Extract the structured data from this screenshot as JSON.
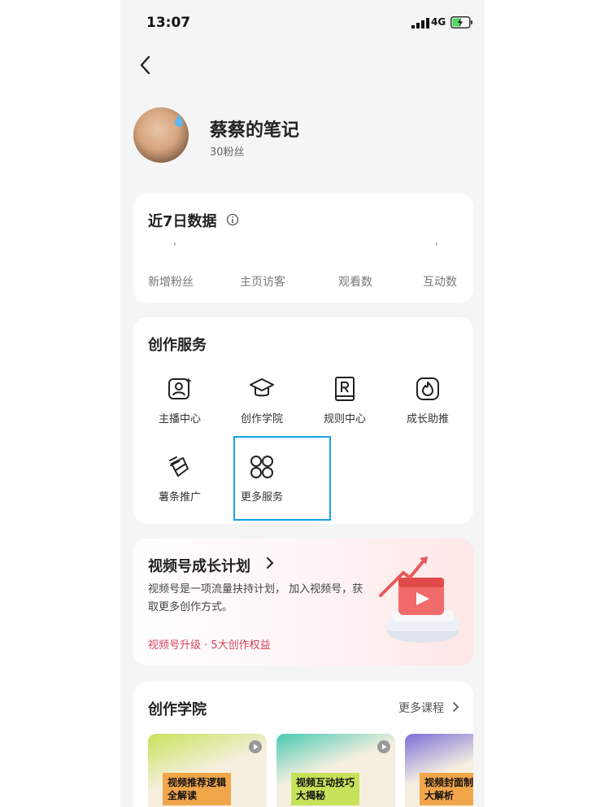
{
  "status_bar": {
    "time": "13:07",
    "network": "4G"
  },
  "profile": {
    "name": "蔡蔡的笔记",
    "followers": "30粉丝"
  },
  "stats_card": {
    "title": "近7日数据",
    "labels": [
      "新增粉丝",
      "主页访客",
      "观看数",
      "互动数"
    ]
  },
  "services_card": {
    "title": "创作服务",
    "items": [
      {
        "label": "主播中心",
        "icon": "anchor-center-icon"
      },
      {
        "label": "创作学院",
        "icon": "graduation-cap-icon"
      },
      {
        "label": "规则中心",
        "icon": "rules-book-icon"
      },
      {
        "label": "成长助推",
        "icon": "flame-boost-icon"
      },
      {
        "label": "薯条推广",
        "icon": "fries-promo-icon"
      },
      {
        "label": "更多服务",
        "icon": "more-services-icon"
      }
    ]
  },
  "growth_plan": {
    "title": "视频号成长计划",
    "description": "视频号是一项流量扶持计划， 加入视频号，获取更多创作方式。",
    "link": "视频号升级 · 5大创作权益"
  },
  "academy": {
    "title": "创作学院",
    "more": "更多课程",
    "courses": [
      {
        "title_line1": "视频推荐逻辑",
        "title_line2": "全解读"
      },
      {
        "title_line1": "视频互动技巧",
        "title_line2": "大揭秘"
      },
      {
        "title_line1": "视频封面制",
        "title_line2": "大解析"
      }
    ]
  },
  "colors": {
    "accent_red": "#d0465a",
    "highlight_border": "#1ba1e2"
  }
}
